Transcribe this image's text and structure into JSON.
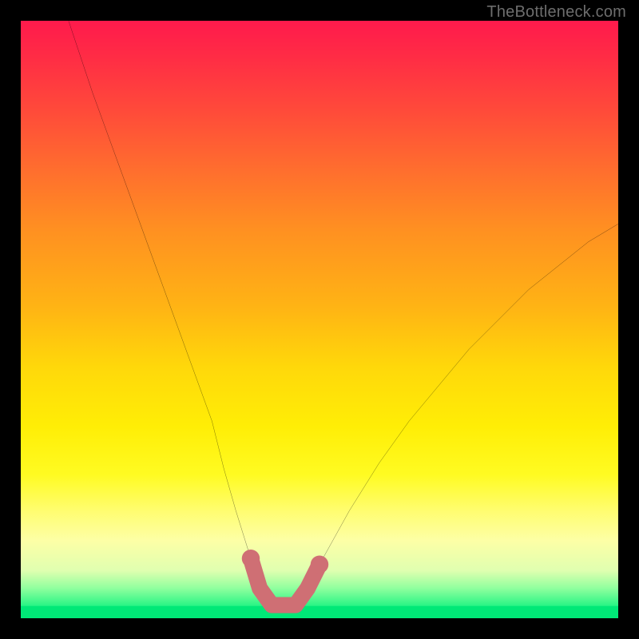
{
  "watermark": {
    "text": "TheBottleneck.com"
  },
  "palette": {
    "frame_bg": "#000000",
    "curve_stroke": "#000000",
    "highlight_stroke": "#cf6f74",
    "highlight_fill": "#cf6f74",
    "gradient_top": "#ff1a4c",
    "gradient_mid": "#ffee06",
    "gradient_bottom": "#00e877"
  },
  "chart_data": {
    "type": "line",
    "title": "",
    "xlabel": "",
    "ylabel": "",
    "xlim": [
      0,
      100
    ],
    "ylim": [
      0,
      100
    ],
    "grid": false,
    "legend": false,
    "series": [
      {
        "name": "bottleneck-curve",
        "x": [
          8,
          12,
          16,
          20,
          24,
          28,
          32,
          34,
          36,
          38.5,
          40,
          42,
          44,
          46,
          48,
          50,
          55,
          60,
          65,
          70,
          75,
          80,
          85,
          90,
          95,
          100
        ],
        "y": [
          100,
          88,
          77,
          66,
          55,
          44,
          33,
          25,
          18,
          10,
          5,
          2.2,
          2.2,
          2.2,
          5,
          9,
          18,
          26,
          33,
          39,
          45,
          50,
          55,
          59,
          63,
          66
        ]
      }
    ],
    "highlight_segment": {
      "name": "optimal-range",
      "x": [
        38.5,
        40,
        42,
        44,
        46,
        48,
        50
      ],
      "y": [
        10,
        5,
        2.2,
        2.2,
        2.2,
        5,
        9
      ]
    },
    "annotations": []
  }
}
